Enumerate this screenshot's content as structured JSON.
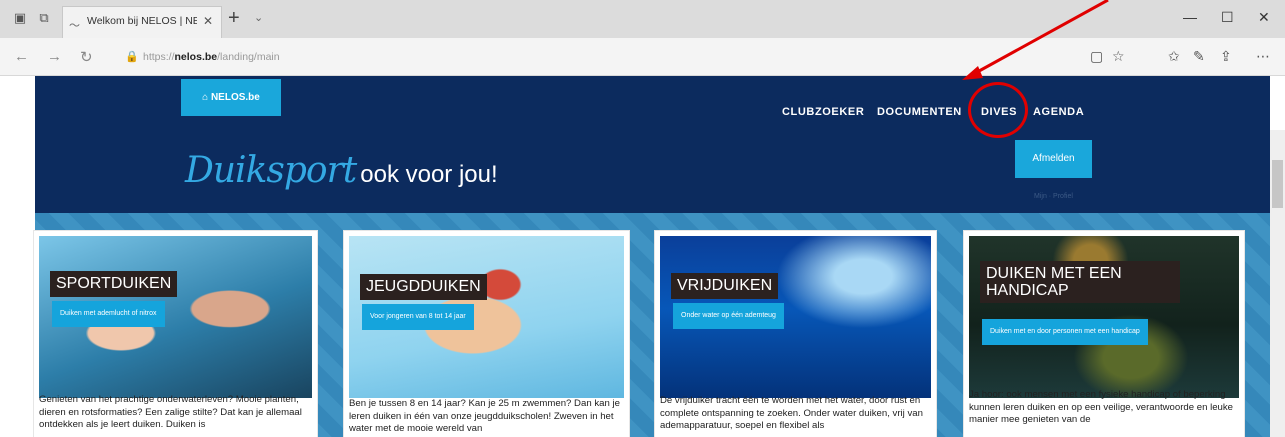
{
  "browser": {
    "tab_title": "Welkom bij NELOS | NEL",
    "url_prefix": "https://",
    "url_domain": "nelos.be",
    "url_path": "/landing/main"
  },
  "header": {
    "logo": "NELOS.be",
    "nav": [
      "CLUBZOEKER",
      "DOCUMENTEN",
      "DIVES",
      "AGENDA"
    ],
    "tagline_script": "Duiksport",
    "tagline_rest": "ook voor jou!",
    "login_button": "Afmelden",
    "login_sub": "Mijn · Profiel"
  },
  "cards": [
    {
      "title": "SPORTDUIKEN",
      "button": "Duiken met adem­lucht of nitrox",
      "text": "Genieten van het prachtige onderwaterleven? Mooie planten, dieren en rotsformaties? Een zalige stilte? Dat kan je allemaal ontdekken als je leert duiken. Duiken is"
    },
    {
      "title": "JEUGDDUIKEN",
      "button": "Voor jongeren van 8 tot 14 jaar",
      "text": "Ben je tussen 8 en 14 jaar? Kan je 25 m zwemmen? Dan kan je leren duiken in één van onze jeugdduikscholen! Zweven in het water met de mooie wereld van"
    },
    {
      "title": "VRIJDUIKEN",
      "button": "Onder water op één ademteug",
      "text": "De vrijduiker tracht één te worden met het water, door rust en complete ontspanning te zoeken. Onder water duiken, vrij van ademapparatuur, soepel en flexibel als"
    },
    {
      "title": "DUIKEN MET EEN HANDICAP",
      "button": "Duiken met en door personen met een handicap",
      "text": "Ja hoor: ook mensen met een fysieke handicap of beperking kunnen leren duiken en op een veilige, verantwoorde en leuke manier mee genieten van de"
    }
  ],
  "colors": {
    "header_bg": "#0c2b5e",
    "accent": "#1aa7db",
    "highlight": "#e00000"
  }
}
